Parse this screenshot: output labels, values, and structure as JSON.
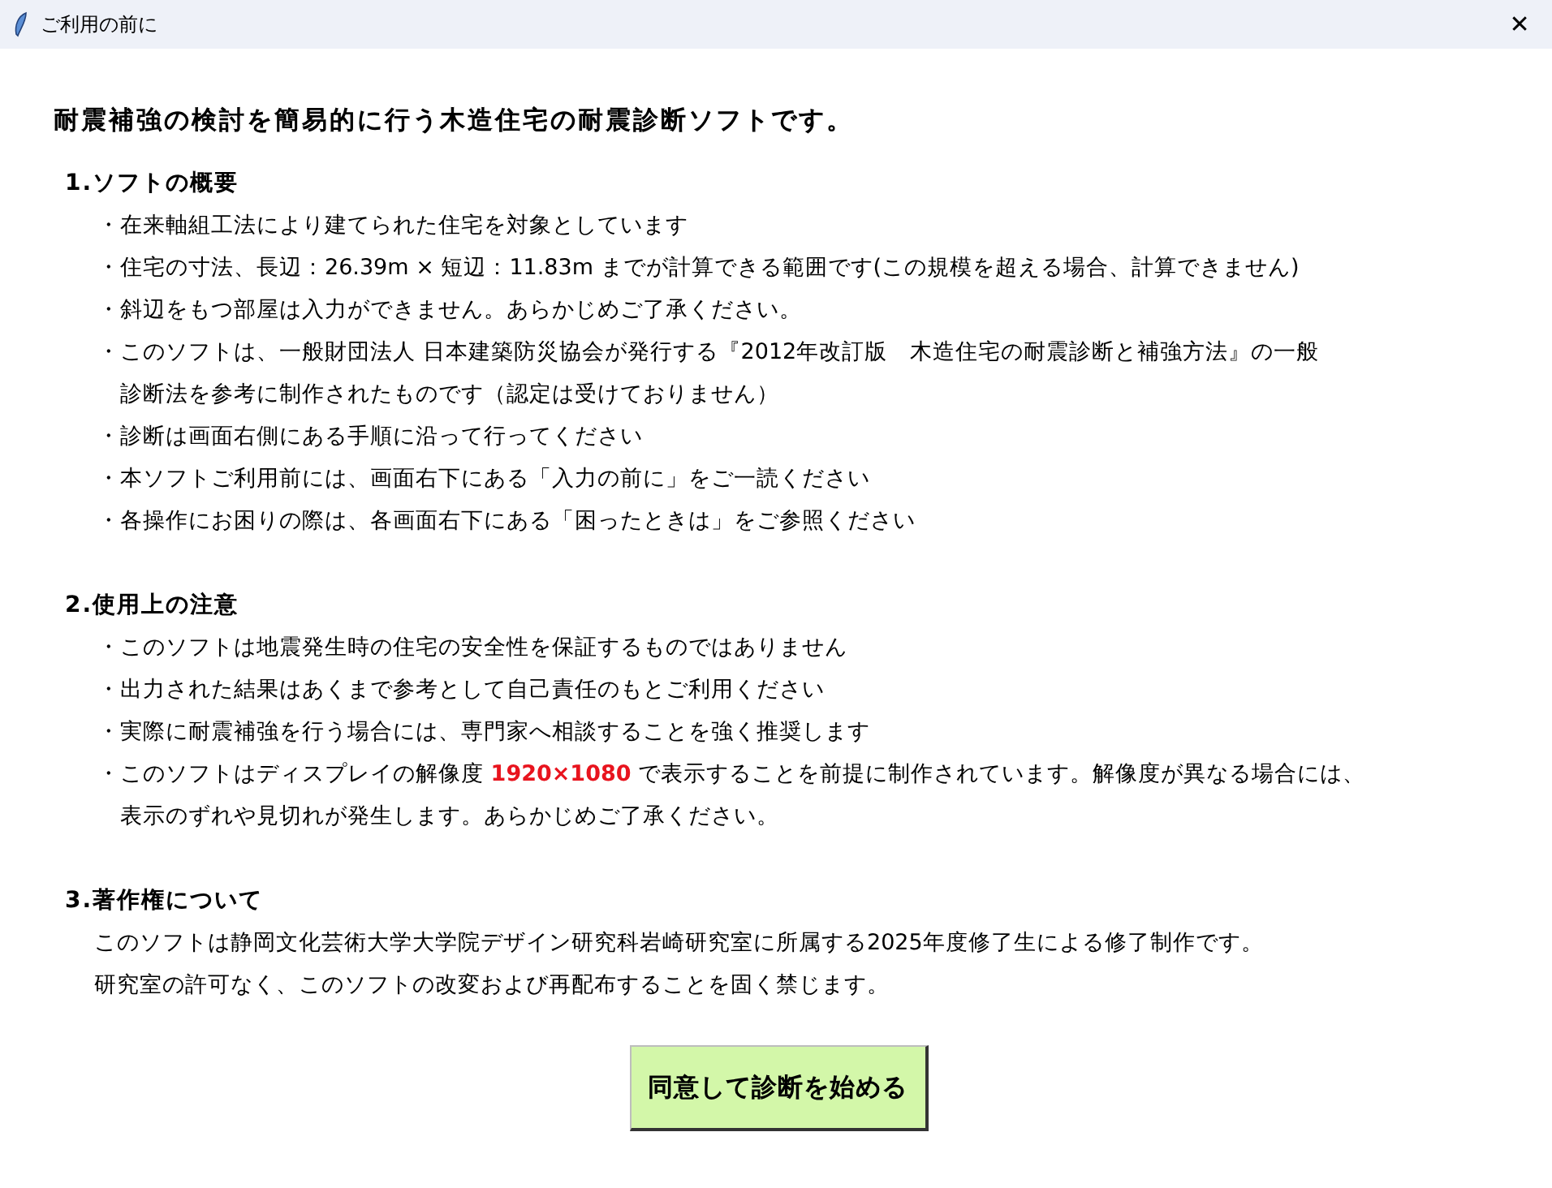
{
  "window": {
    "title": "ご利用の前に",
    "close": "✕"
  },
  "heading": "耐震補強の検討を簡易的に行う木造住宅の耐震診断ソフトです。",
  "sections": [
    {
      "title": "1.ソフトの概要",
      "kind": "bullets",
      "items": [
        {
          "bullet": "・",
          "lines": [
            "在来軸組工法により建てられた住宅を対象としています"
          ]
        },
        {
          "bullet": "・",
          "lines": [
            "住宅の寸法、長辺：26.39m × 短辺：11.83m までが計算できる範囲です(この規模を超える場合、計算できません)"
          ]
        },
        {
          "bullet": "・",
          "lines": [
            "斜辺をもつ部屋は入力ができません。あらかじめご了承ください。"
          ]
        },
        {
          "bullet": "・",
          "lines": [
            "このソフトは、一般財団法人 日本建築防災協会が発行する『2012年改訂版　木造住宅の耐震診断と補強方法』の一般",
            "診断法を参考に制作されたものです（認定は受けておりません）"
          ]
        },
        {
          "bullet": "・",
          "lines": [
            "診断は画面右側にある手順に沿って行ってください"
          ]
        },
        {
          "bullet": "・",
          "lines": [
            "本ソフトご利用前には、画面右下にある「入力の前に」をご一読ください"
          ]
        },
        {
          "bullet": "・",
          "lines": [
            "各操作にお困りの際は、各画面右下にある「困ったときは」をご参照ください"
          ]
        }
      ]
    },
    {
      "title": "2.使用上の注意",
      "kind": "bullets",
      "items": [
        {
          "bullet": "・",
          "lines": [
            "このソフトは地震発生時の住宅の安全性を保証するものではありません"
          ]
        },
        {
          "bullet": "・",
          "lines": [
            "出力された結果はあくまで参考として自己責任のもとご利用ください"
          ]
        },
        {
          "bullet": "・",
          "lines": [
            "実際に耐震補強を行う場合には、専門家へ相談することを強く推奨します"
          ]
        },
        {
          "bullet": "・",
          "lines": [
            [
              {
                "text": "このソフトはディスプレイの解像度 ",
                "kind": "plain"
              },
              {
                "text": "1920×1080",
                "kind": "highlight"
              },
              {
                "text": " で表示することを前提に制作されています。解像度が異なる場合には、",
                "kind": "plain"
              }
            ],
            "表示のずれや見切れが発生します。あらかじめご了承ください。"
          ]
        }
      ]
    },
    {
      "title": "3.著作権について",
      "kind": "paragraph",
      "items": [
        {
          "lines": [
            "このソフトは静岡文化芸術大学大学院デザイン研究科岩崎研究室に所属する2025年度修了生による修了制作です。"
          ]
        },
        {
          "lines": [
            "研究室の許可なく、このソフトの改変および再配布することを固く禁じます。"
          ]
        }
      ]
    }
  ],
  "button": "同意して診断を始める"
}
